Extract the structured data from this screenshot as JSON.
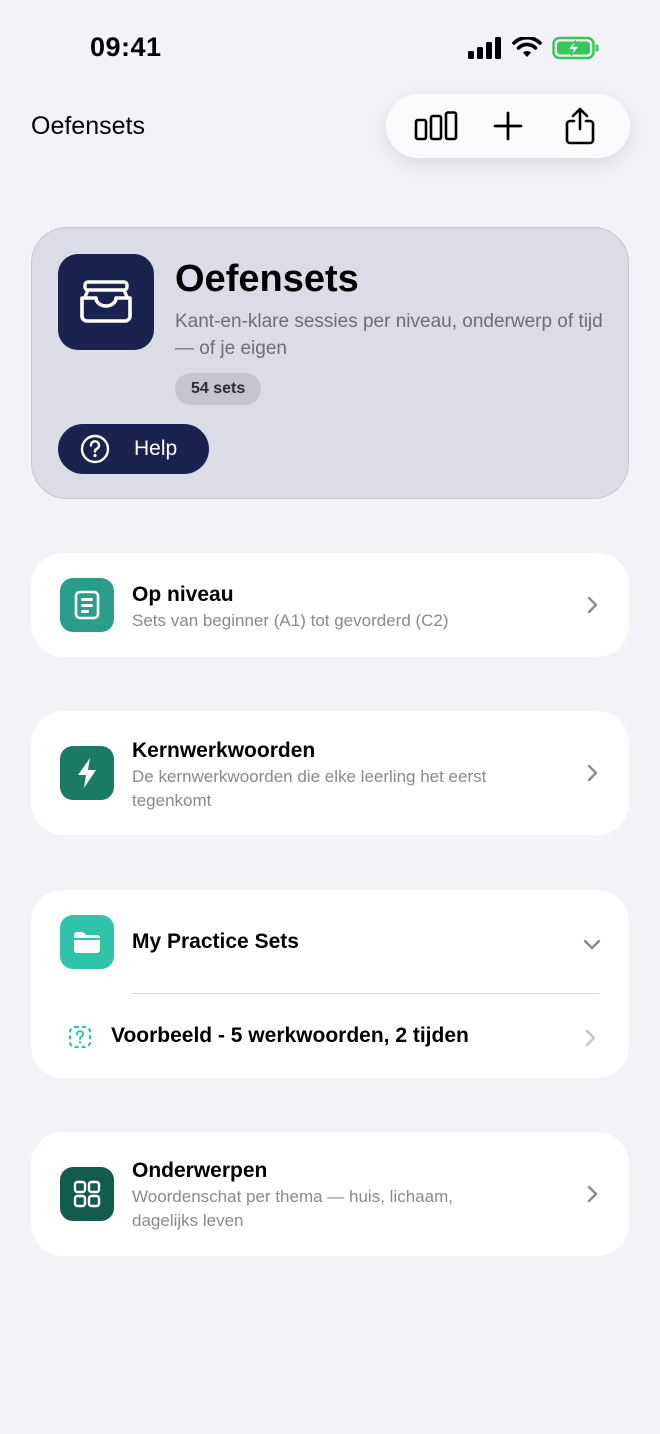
{
  "status_bar": {
    "time": "09:41"
  },
  "nav": {
    "title": "Oefensets"
  },
  "toolbar": {
    "stats_icon": "bar-chart-icon",
    "add_icon": "plus-icon",
    "share_icon": "share-icon"
  },
  "hero": {
    "title": "Oefensets",
    "subtitle": "Kant-en-klare sessies per niveau, onderwerp of tijd — of je eigen",
    "badge": "54 sets",
    "help_label": "Help"
  },
  "cards": {
    "level": {
      "title": "Op niveau",
      "subtitle": "Sets van beginner (A1) tot gevorderd (C2)"
    },
    "core_verbs": {
      "title": "Kernwerkwoorden",
      "subtitle": "De kernwerkwoorden die elke leerling het eerst tegenkomt"
    },
    "my_sets": {
      "title": "My Practice Sets",
      "item_label": "Voorbeeld - 5 werkwoorden, 2 tijden"
    },
    "topics": {
      "title": "Onderwerpen",
      "subtitle": "Woordenschat per thema — huis, lichaam, dagelijks leven"
    }
  },
  "colors": {
    "navy": "#1a2350",
    "teal_level": "#2a9d8c",
    "green_verbs": "#1a7a62",
    "teal_folder": "#2fc4a9",
    "green_topics": "#135c4c",
    "background": "#f2f2f7"
  }
}
